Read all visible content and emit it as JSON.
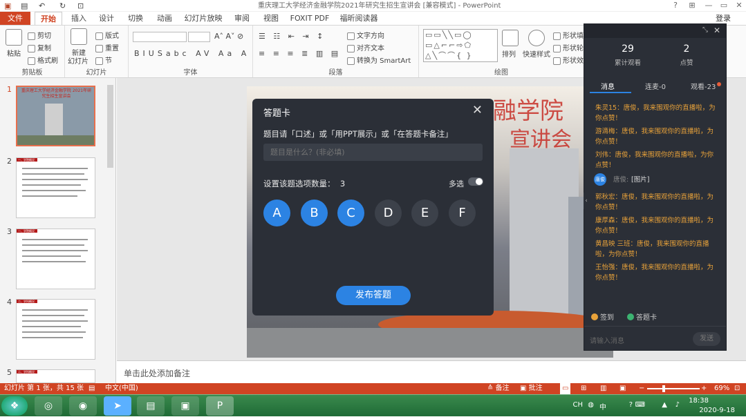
{
  "window": {
    "title": "重庆理工大学经济金融学院2021年研究生招生宣讲会 [兼容模式] - PowerPoint",
    "help": "?",
    "minimize": "—",
    "restore": "▭",
    "close": "✕"
  },
  "tabs": [
    "文件",
    "开始",
    "插入",
    "设计",
    "切换",
    "动画",
    "幻灯片放映",
    "审阅",
    "视图",
    "FOXIT PDF",
    "福昕阅读器"
  ],
  "login": "登录",
  "ribbon": {
    "clipboard": {
      "paste": "粘贴",
      "cut": "剪切",
      "copy": "复制",
      "format_painter": "格式刷",
      "label": "剪贴板"
    },
    "slides": {
      "new_slide": "新建",
      "new_slide2": "幻灯片",
      "layout": "版式",
      "reset": "重置",
      "section": "节",
      "label": "幻灯片"
    },
    "font": {
      "label": "字体"
    },
    "paragraph": {
      "text_direction": "文字方向",
      "align_text": "对齐文本",
      "smartart": "转换为 SmartArt",
      "label": "段落"
    },
    "drawing": {
      "arrange": "排列",
      "quick_styles": "快速样式",
      "shape_fill": "形状填",
      "shape_outline": "形状轮",
      "shape_effects": "形状效",
      "label": "绘图"
    }
  },
  "thumbnails": [
    {
      "num": "1",
      "title": "重庆理工大学经济金融学院 2021年研究生招生宣讲会"
    },
    {
      "num": "2",
      "title": "一、学院概况"
    },
    {
      "num": "3",
      "title": "一、学院概况"
    },
    {
      "num": "4",
      "title": "二、学科概况"
    },
    {
      "num": "5",
      "title": "二、学科概况"
    }
  ],
  "slide": {
    "title_line1": "重庆理工大学经济金融学院",
    "title_line2": "宣讲会"
  },
  "notes_placeholder": "单击此处添加备注",
  "quiz": {
    "title": "答题卡",
    "close": "✕",
    "prompt": "题目请「口述」或「用PPT展示」或「在答题卡备注」",
    "input_placeholder": "题目是什么？(非必填)",
    "option_count_label": "设置该题选项数量：",
    "option_count": "3",
    "multi_label": "多选",
    "options": [
      "A",
      "B",
      "C",
      "D",
      "E",
      "F"
    ],
    "submit": "发布答题"
  },
  "live": {
    "viewers_total": "29",
    "viewers_label": "累计观看",
    "likes": "2",
    "likes_label": "点赞",
    "tab_messages": "消息",
    "tab_connect": "连麦-0",
    "tab_viewers": "观看-23",
    "messages": [
      "朱灵15：唐俊，我来围观你的直播啦，为你点赞！",
      "游滴梅：唐俊，我来围观你的直播啦，为你点赞！",
      "刘伟：唐俊，我来围观你的直播啦，为你点赞！",
      "郭秋宏：唐俊，我来围观你的直播啦，为你点赞！",
      "康厚森：唐俊，我来围观你的直播啦，为你点赞！",
      "黄昌映 三班：唐俊，我来围观你的直播啦，为你点赞！",
      "王怡强：唐俊，我来围观你的直播啦，为你点赞！"
    ],
    "image_msg_sender": "唐俊:",
    "image_msg": "[图片]",
    "avatar": "唐俊",
    "signin": "签到",
    "answer_card": "答题卡",
    "input_placeholder": "请输入消息",
    "send": "发送"
  },
  "statusbar": {
    "slide_info": "幻灯片 第 1 张，共 15 张",
    "language": "中文(中国)",
    "notes": "备注",
    "comments": "批注",
    "zoom": "69%"
  },
  "taskbar": {
    "ime": "CH",
    "ime2": "中",
    "time": "18:38",
    "date": "2020-9-18"
  }
}
